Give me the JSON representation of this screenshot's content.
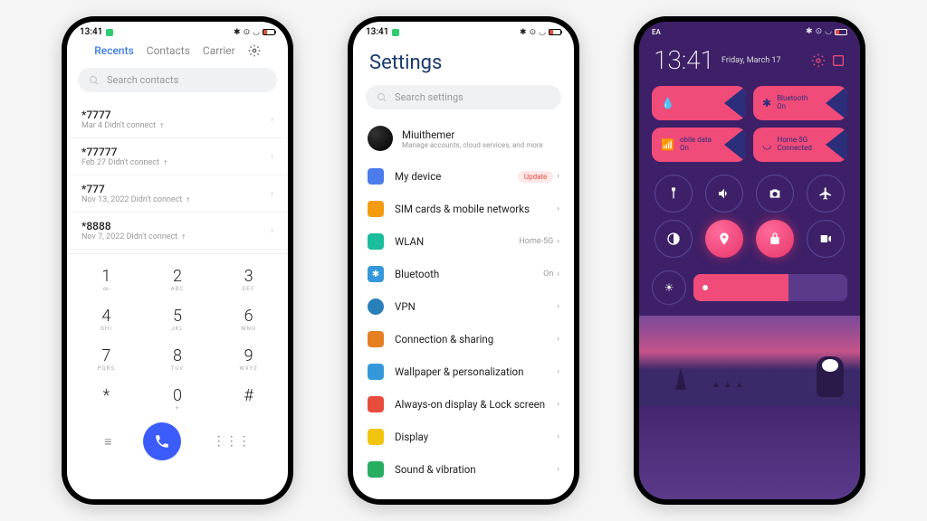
{
  "status": {
    "time": "13:41",
    "ea": "EA"
  },
  "dialer": {
    "tabs": {
      "recents": "Recents",
      "contacts": "Contacts",
      "carrier": "Carrier"
    },
    "search_placeholder": "Search contacts",
    "calls": [
      {
        "number": "*7777",
        "sub": "Mar 4 Didn't connect"
      },
      {
        "number": "*77777",
        "sub": "Feb 27 Didn't connect"
      },
      {
        "number": "*777",
        "sub": "Nov 13, 2022 Didn't connect"
      },
      {
        "number": "*8888",
        "sub": "Nov 7, 2022 Didn't connect"
      }
    ],
    "keys": [
      {
        "d": "1",
        "l": "∞"
      },
      {
        "d": "2",
        "l": "ABC"
      },
      {
        "d": "3",
        "l": "DEF"
      },
      {
        "d": "4",
        "l": "GHI"
      },
      {
        "d": "5",
        "l": "JKL"
      },
      {
        "d": "6",
        "l": "MNO"
      },
      {
        "d": "7",
        "l": "PQRS"
      },
      {
        "d": "8",
        "l": "TUV"
      },
      {
        "d": "9",
        "l": "WXYZ"
      },
      {
        "d": "*",
        "l": ""
      },
      {
        "d": "0",
        "l": "+"
      },
      {
        "d": "#",
        "l": ""
      }
    ]
  },
  "settings": {
    "title": "Settings",
    "search_placeholder": "Search settings",
    "account": {
      "name": "Miuithemer",
      "sub": "Manage accounts, cloud services, and more"
    },
    "items": [
      {
        "icon_bg": "#4b7bec",
        "label": "My device",
        "right": "Update",
        "badge": true
      },
      {
        "icon_bg": "#f39c12",
        "label": "SIM cards & mobile networks",
        "right": ""
      },
      {
        "icon_bg": "#1abc9c",
        "label": "WLAN",
        "right": "Home-5G"
      },
      {
        "icon_bg": "#3498db",
        "label": "Bluetooth",
        "right": "On"
      },
      {
        "icon_bg": "#2980b9",
        "label": "VPN",
        "right": ""
      },
      {
        "icon_bg": "#e67e22",
        "label": "Connection & sharing",
        "right": ""
      },
      {
        "icon_bg": "#3498db",
        "label": "Wallpaper & personalization",
        "right": ""
      },
      {
        "icon_bg": "#e74c3c",
        "label": "Always-on display & Lock screen",
        "right": ""
      },
      {
        "icon_bg": "#f1c40f",
        "label": "Display",
        "right": ""
      },
      {
        "icon_bg": "#27ae60",
        "label": "Sound & vibration",
        "right": ""
      }
    ]
  },
  "control": {
    "clock": "13:41",
    "date": "Friday, March 17",
    "tiles": [
      {
        "icon": "drop",
        "line1": "",
        "line2": ""
      },
      {
        "icon": "bt",
        "line1": "Bluetooth",
        "line2": "On"
      },
      {
        "icon": "cell",
        "line1": "obile data",
        "line2": "On"
      },
      {
        "icon": "wifi",
        "line1": "Home-5G",
        "line2": "Connected"
      }
    ],
    "toggles": [
      "flashlight",
      "volume",
      "camera",
      "airplane",
      "contrast",
      "location",
      "lock",
      "video"
    ],
    "active_toggles": [
      "location",
      "lock"
    ]
  }
}
